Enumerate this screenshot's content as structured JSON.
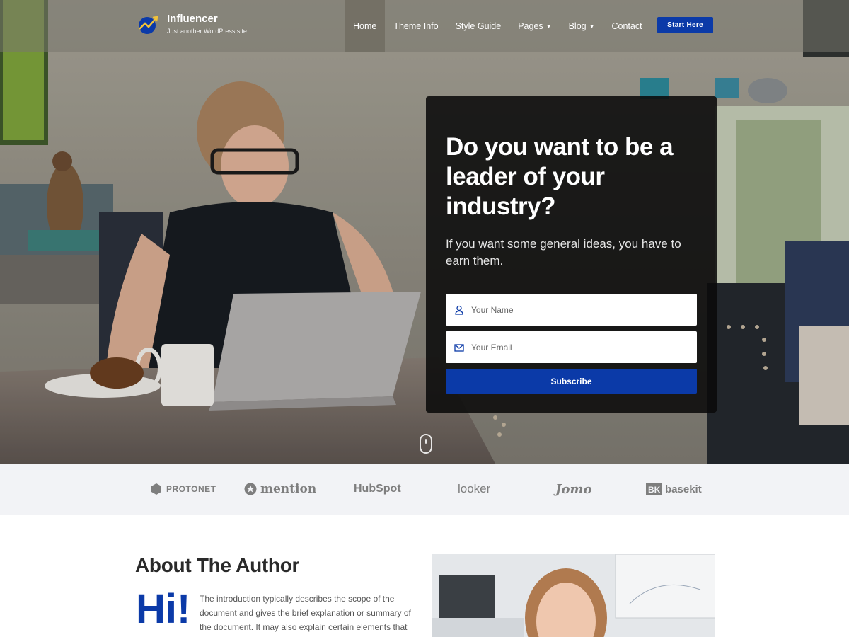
{
  "site": {
    "title": "Influencer",
    "tagline": "Just another WordPress site"
  },
  "nav": {
    "items": [
      {
        "label": "Home",
        "active": true
      },
      {
        "label": "Theme Info"
      },
      {
        "label": "Style Guide"
      },
      {
        "label": "Pages",
        "dropdown": true
      },
      {
        "label": "Blog",
        "dropdown": true
      },
      {
        "label": "Contact"
      }
    ],
    "cta_label": "Start Here"
  },
  "hero": {
    "heading": "Do you want to be a leader of your industry?",
    "subheading": "If you want some general ideas, you have to earn them.",
    "name_placeholder": "Your Name",
    "email_placeholder": "Your Email",
    "subscribe_label": "Subscribe"
  },
  "logos": [
    {
      "name": "PROTONET"
    },
    {
      "name": "mention"
    },
    {
      "name": "HubSpot"
    },
    {
      "name": "looker"
    },
    {
      "name": "Jomo"
    },
    {
      "name": "basekit"
    }
  ],
  "about": {
    "title": "About The Author",
    "dropcap": "Hi!",
    "text": "The introduction typically describes the scope of the document and gives the brief explanation or summary of the document. It may also explain certain elements that are important to the essay if explanations are not part of the main text."
  },
  "colors": {
    "accent": "#0b3aa8",
    "logo_strip_bg": "#f2f3f6",
    "card_bg": "#0a0a0a"
  }
}
